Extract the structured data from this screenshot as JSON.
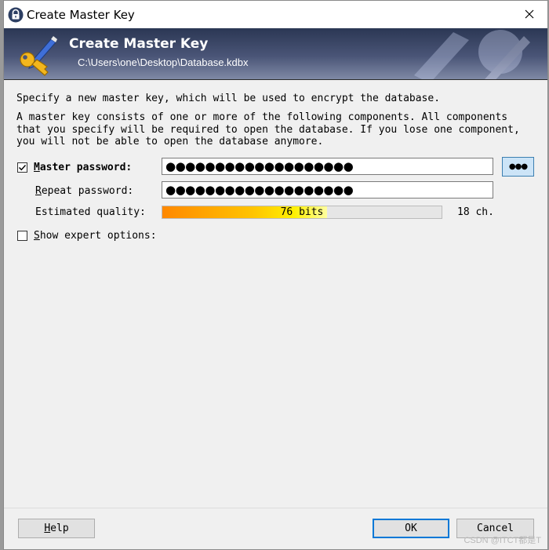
{
  "window": {
    "title": "Create Master Key"
  },
  "banner": {
    "title": "Create Master Key",
    "subtitle": "C:\\Users\\one\\Desktop\\Database.kdbx"
  },
  "content": {
    "intro": "Specify a new master key, which will be used to encrypt the database.",
    "description": "A master key consists of one or more of the following components. All components that you specify will be required to open the database.  If you lose one component, you will not be able to open the database anymore."
  },
  "master_password": {
    "checked": true,
    "label_accel": "M",
    "label_rest": "aster password:",
    "value": "●●●●●●●●●●●●●●●●●●●"
  },
  "reveal_button": {
    "label": "●●●"
  },
  "repeat_password": {
    "label_accel": "R",
    "label_rest": "epeat password:",
    "value": "●●●●●●●●●●●●●●●●●●●"
  },
  "quality": {
    "label": "Estimated quality:",
    "bar_text": "76 bits",
    "fill_fraction": 0.59,
    "chars_text": "18 ch."
  },
  "expert_options": {
    "checked": false,
    "label_accel": "S",
    "label_rest": "how expert options:"
  },
  "buttons": {
    "help_accel": "H",
    "help_rest": "elp",
    "ok_label": "OK",
    "cancel_label": "Cancel"
  },
  "watermark": "CSDN @ITCT都是T",
  "colors": {
    "accent": "#0078d7",
    "banner_dark": "#2b3754",
    "quality_start": "#ff8800",
    "quality_end": "#fffea0"
  },
  "icons": {
    "app": "lock-icon",
    "close": "close-icon",
    "banner": "key-pen-icon",
    "check": "checkmark-icon",
    "reveal": "dots-icon"
  }
}
